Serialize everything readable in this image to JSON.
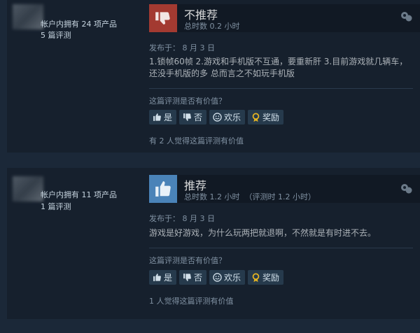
{
  "reviews": [
    {
      "product_count": "帐户内拥有 24 项产品",
      "review_count": "5 篇评测",
      "verdict": "不推荐",
      "playtime": "总时数 0.2 小时",
      "posted": "发布于：  8 月 3 日",
      "text": "1.锁帧60帧 2.游戏和手机版不互通，要重新肝 3.目前游戏就几辆车，还没手机版的多 总而言之不如玩手机版",
      "helpful_question": "这篇评测是否有价值？",
      "yes_label": "是",
      "no_label": "否",
      "funny_label": "欢乐",
      "award_label": "奖励",
      "helpful_count": "有 2 人觉得这篇评测有价值"
    },
    {
      "product_count": "帐户内拥有 11 项产品",
      "review_count": "1 篇评测",
      "verdict": "推荐",
      "playtime": "总时数 1.2 小时  （评测时 1.2 小时）",
      "posted": "发布于：  8 月 3 日",
      "text": "游戏是好游戏，为什么玩两把就退啊，不然就是有时进不去。",
      "helpful_question": "这篇评测是否有价值？",
      "yes_label": "是",
      "no_label": "否",
      "funny_label": "欢乐",
      "award_label": "奖励",
      "helpful_count": "1 人觉得这篇评测有价值"
    }
  ],
  "colors": {
    "thumbs_down_bg": "#a33a31",
    "thumbs_up_bg": "#4a83b8",
    "page_bg": "#1b2838",
    "card_bg": "#16202d"
  },
  "icons": {
    "thumbs_down": "thumbs-down-icon",
    "thumbs_up": "thumbs-up-icon",
    "comment": "comment-icon",
    "funny": "smiley-icon",
    "award": "award-icon"
  }
}
